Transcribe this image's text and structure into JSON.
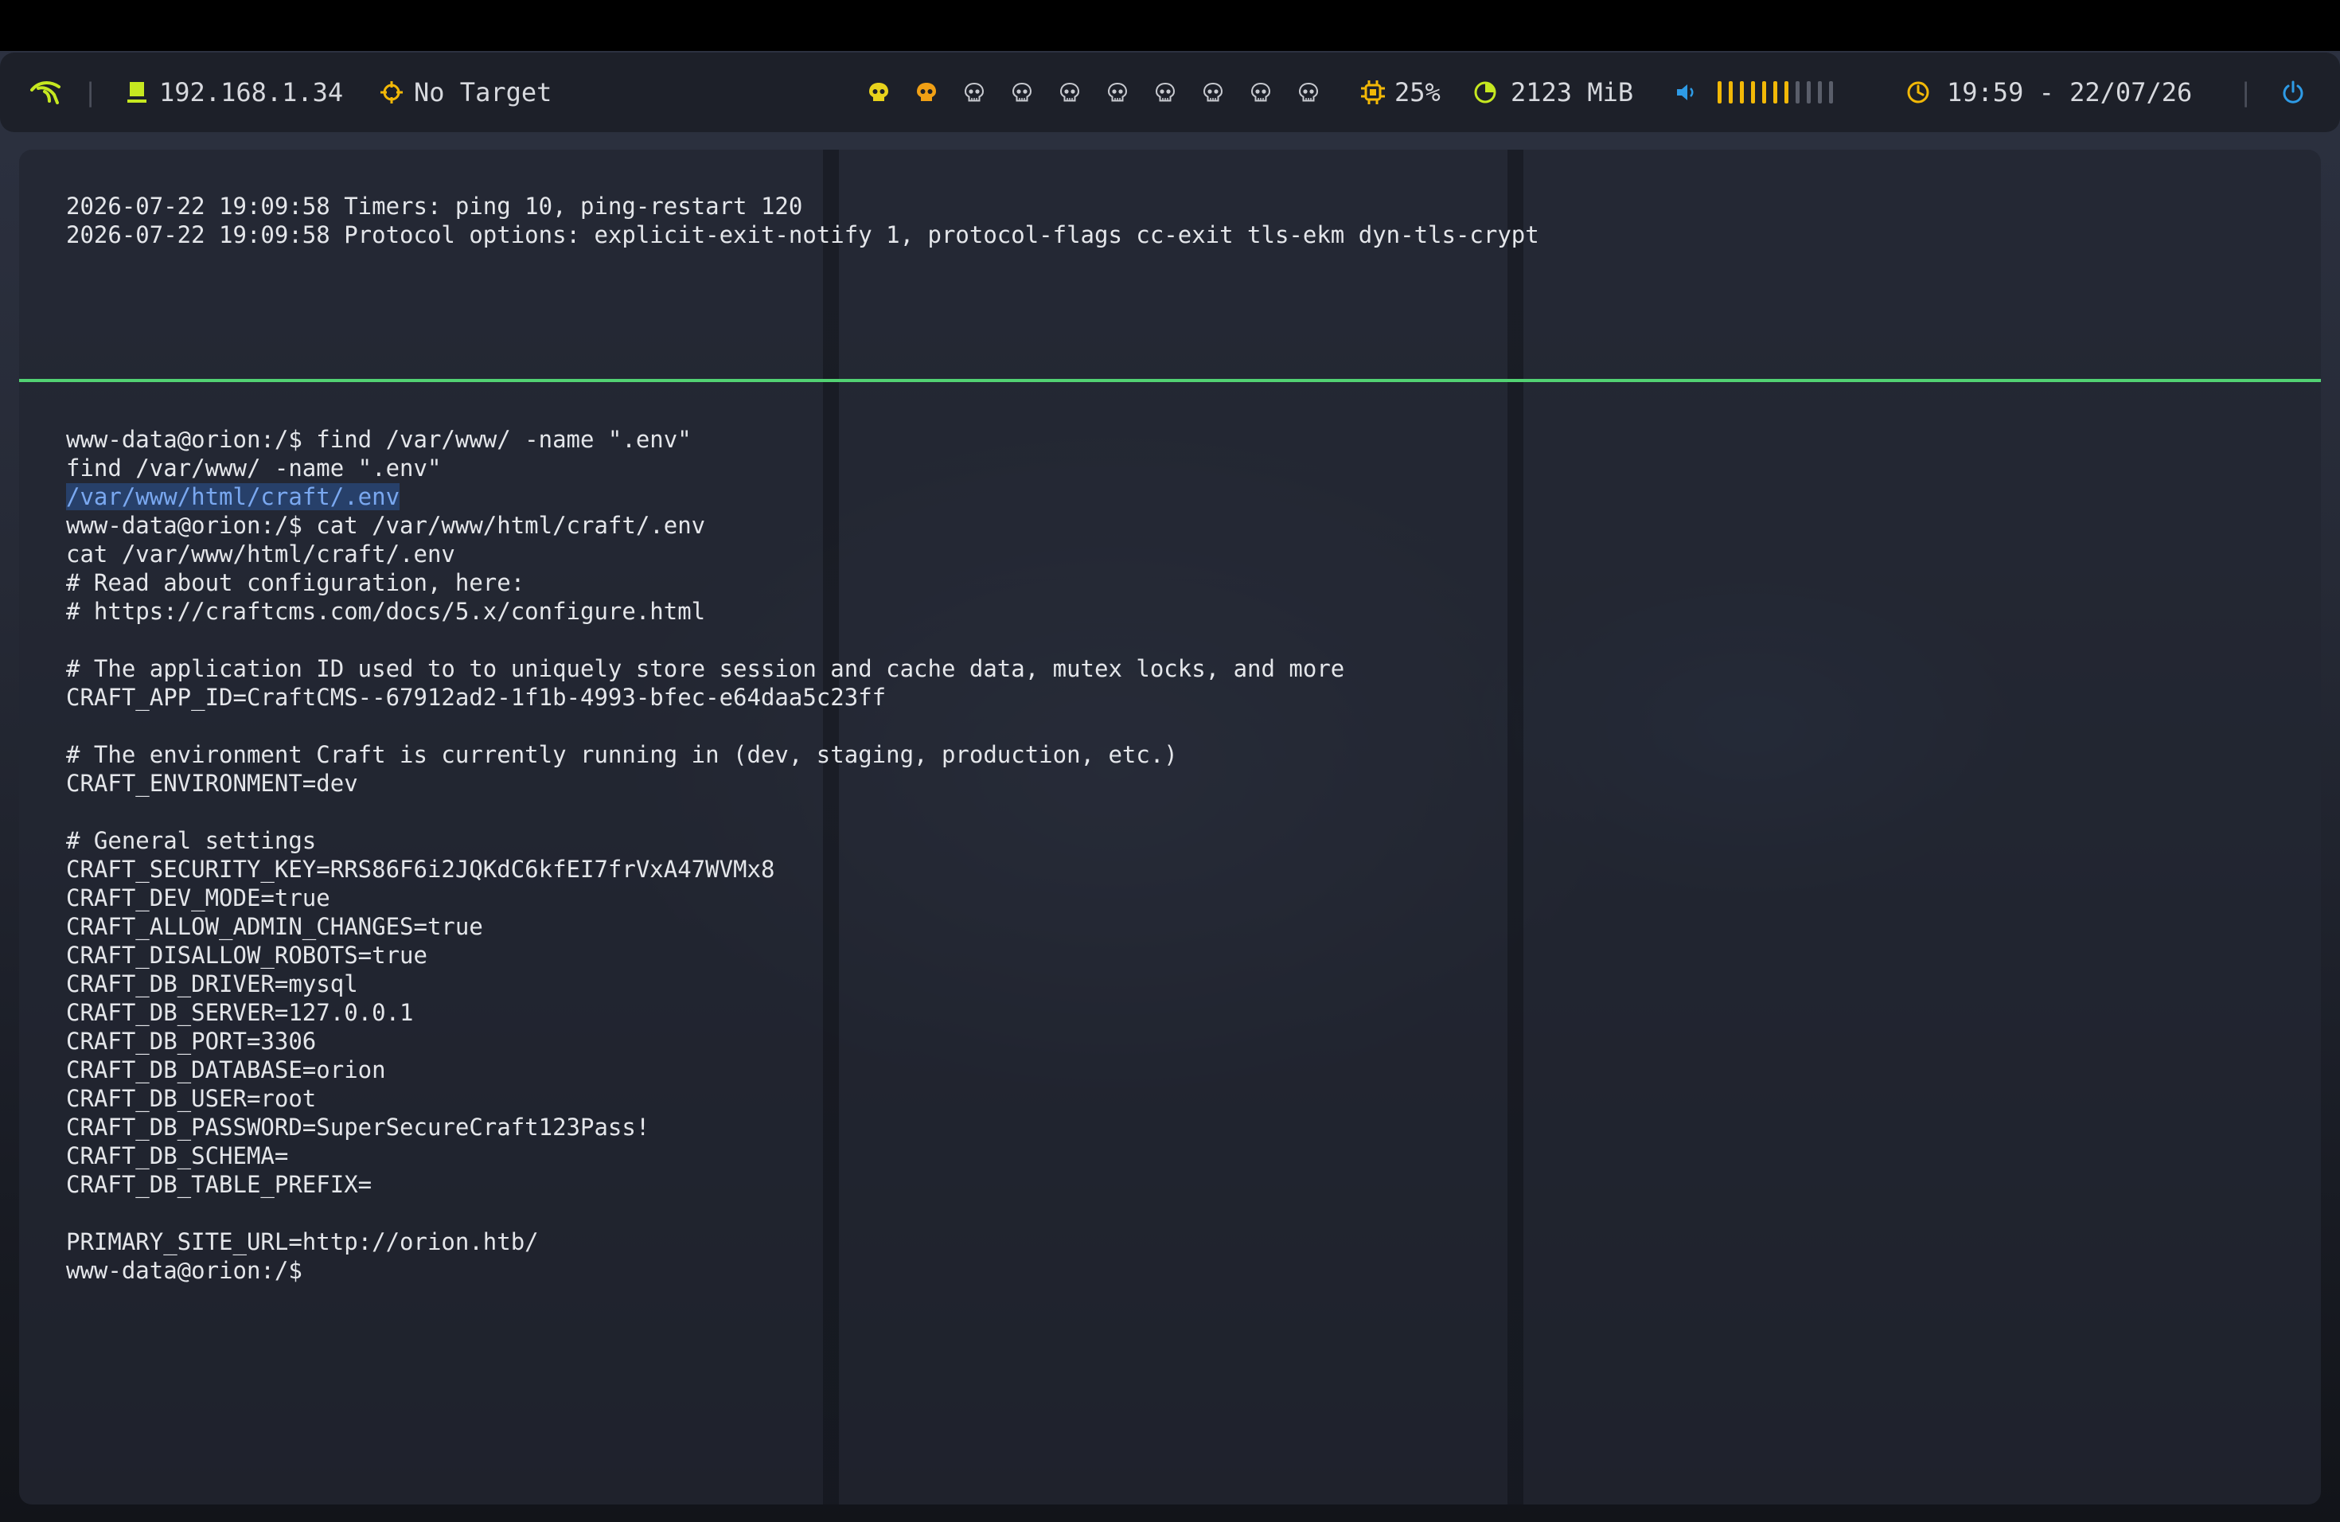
{
  "topbar": {
    "ip": "192.168.1.34",
    "target": "No Target",
    "workspaces": [
      {
        "state": "active",
        "color": "#e8d21c"
      },
      {
        "state": "occupied",
        "color": "#f0a015"
      },
      {
        "state": "empty",
        "color": "#c8cad0"
      },
      {
        "state": "empty",
        "color": "#c8cad0"
      },
      {
        "state": "empty",
        "color": "#c8cad0"
      },
      {
        "state": "empty",
        "color": "#c8cad0"
      },
      {
        "state": "empty",
        "color": "#c8cad0"
      },
      {
        "state": "empty",
        "color": "#c8cad0"
      },
      {
        "state": "empty",
        "color": "#c8cad0"
      },
      {
        "state": "empty",
        "color": "#c8cad0"
      }
    ],
    "cpu": "25%",
    "memory": "2123 MiB",
    "volume_level": 0.6,
    "clock": "19:59 - 22/07/26",
    "colors": {
      "accent": "#f2b807",
      "ip_icon": "#c6e820",
      "power": "#2e9be6",
      "volume_icon": "#2e9be6"
    }
  },
  "terminal": {
    "top_pane": [
      "2026-07-22 19:09:58 Timers: ping 10, ping-restart 120",
      "2026-07-22 19:09:58 Protocol options: explicit-exit-notify 1, protocol-flags cc-exit tls-ekm dyn-tls-crypt"
    ],
    "bottom_pane": [
      "www-data@orion:/$ find /var/www/ -name \".env\"",
      "find /var/www/ -name \".env\"",
      "/var/www/html/craft/.env",
      "www-data@orion:/$ cat /var/www/html/craft/.env",
      "cat /var/www/html/craft/.env",
      "# Read about configuration, here:",
      "# https://craftcms.com/docs/5.x/configure.html",
      "",
      "# The application ID used to to uniquely store session and cache data, mutex locks, and more",
      "CRAFT_APP_ID=CraftCMS--67912ad2-1f1b-4993-bfec-e64daa5c23ff",
      "",
      "# The environment Craft is currently running in (dev, staging, production, etc.)",
      "CRAFT_ENVIRONMENT=dev",
      "",
      "# General settings",
      "CRAFT_SECURITY_KEY=RRS86F6i2JQKdC6kfEI7frVxA47WVMx8",
      "CRAFT_DEV_MODE=true",
      "CRAFT_ALLOW_ADMIN_CHANGES=true",
      "CRAFT_DISALLOW_ROBOTS=true",
      "CRAFT_DB_DRIVER=mysql",
      "CRAFT_DB_SERVER=127.0.0.1",
      "CRAFT_DB_PORT=3306",
      "CRAFT_DB_DATABASE=orion",
      "CRAFT_DB_USER=root",
      "CRAFT_DB_PASSWORD=SuperSecureCraft123Pass!",
      "CRAFT_DB_SCHEMA=",
      "CRAFT_DB_TABLE_PREFIX=",
      "",
      "PRIMARY_SITE_URL=http://orion.htb/",
      "www-data@orion:/$ "
    ],
    "selected_line_index": 2
  }
}
